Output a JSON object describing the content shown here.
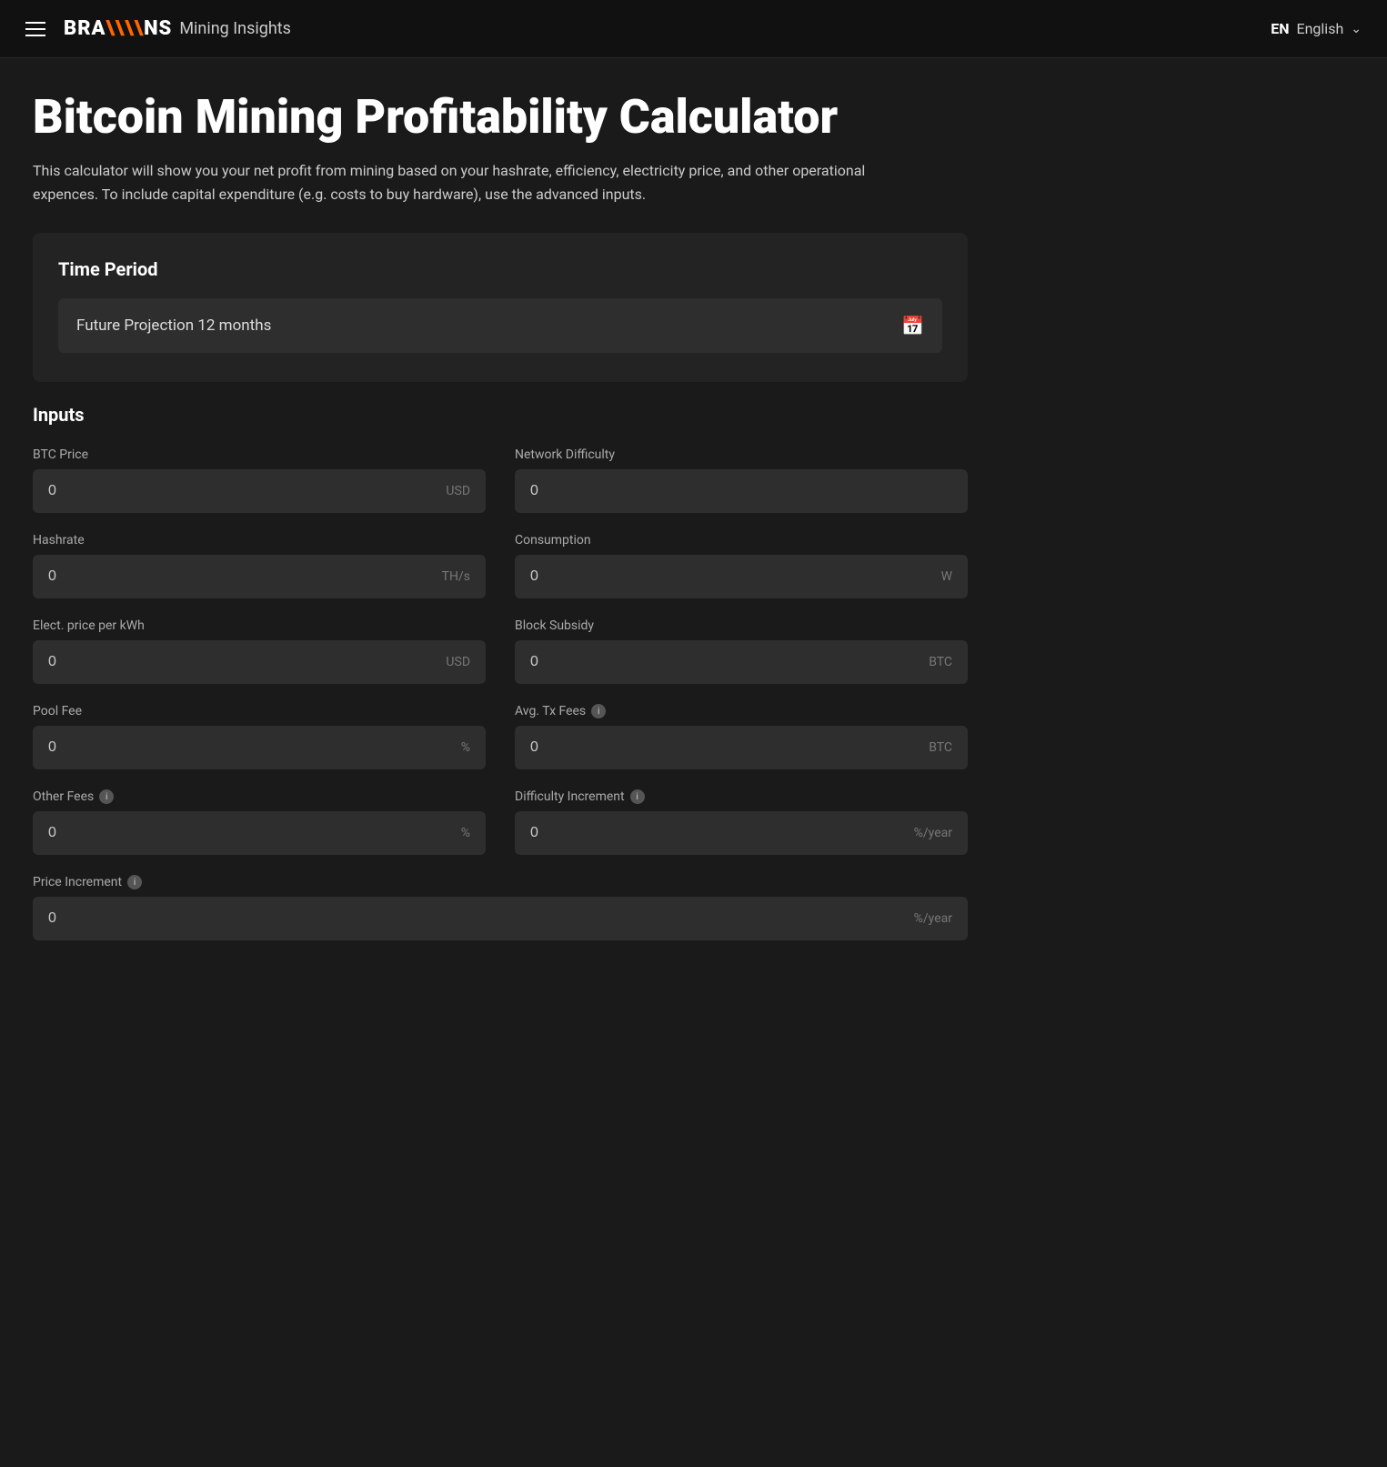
{
  "navbar": {
    "menu_icon": "hamburger-icon",
    "brand_name": "BRA\\\\NS",
    "brand_subtitle": "Mining Insights",
    "lang_code": "EN",
    "lang_name": "English",
    "lang_dropdown": "chevron-down-icon"
  },
  "page": {
    "title": "Bitcoin Mining Profitability Calculator",
    "description": "This calculator will show you your net profit from mining based on your hashrate, efficiency, electricity price, and other operational expences. To include capital expenditure (e.g. costs to buy hardware), use the advanced inputs."
  },
  "time_period": {
    "section_title": "Time Period",
    "selector_text": "Future Projection 12 months",
    "calendar_icon": "📅"
  },
  "inputs": {
    "section_title": "Inputs",
    "fields": [
      {
        "id": "btc-price",
        "label": "BTC Price",
        "value": "0",
        "unit": "USD",
        "has_info": false,
        "full_width": false
      },
      {
        "id": "network-difficulty",
        "label": "Network Difficulty",
        "value": "0",
        "unit": "",
        "has_info": false,
        "full_width": false
      },
      {
        "id": "hashrate",
        "label": "Hashrate",
        "value": "0",
        "unit": "TH/s",
        "has_info": false,
        "full_width": false
      },
      {
        "id": "consumption",
        "label": "Consumption",
        "value": "0",
        "unit": "W",
        "has_info": false,
        "full_width": false
      },
      {
        "id": "elect-price",
        "label": "Elect. price per kWh",
        "value": "0",
        "unit": "USD",
        "has_info": false,
        "full_width": false
      },
      {
        "id": "block-subsidy",
        "label": "Block Subsidy",
        "value": "0",
        "unit": "BTC",
        "has_info": false,
        "full_width": false
      },
      {
        "id": "pool-fee",
        "label": "Pool Fee",
        "value": "0",
        "unit": "%",
        "has_info": false,
        "full_width": false
      },
      {
        "id": "avg-tx-fees",
        "label": "Avg. Tx Fees",
        "value": "0",
        "unit": "BTC",
        "has_info": true,
        "full_width": false
      },
      {
        "id": "other-fees",
        "label": "Other Fees",
        "value": "0",
        "unit": "%",
        "has_info": true,
        "full_width": false
      },
      {
        "id": "difficulty-increment",
        "label": "Difficulty Increment",
        "value": "0",
        "unit": "%/year",
        "has_info": true,
        "full_width": false
      },
      {
        "id": "price-increment",
        "label": "Price Increment",
        "value": "0",
        "unit": "%/year",
        "has_info": true,
        "full_width": true
      }
    ]
  }
}
